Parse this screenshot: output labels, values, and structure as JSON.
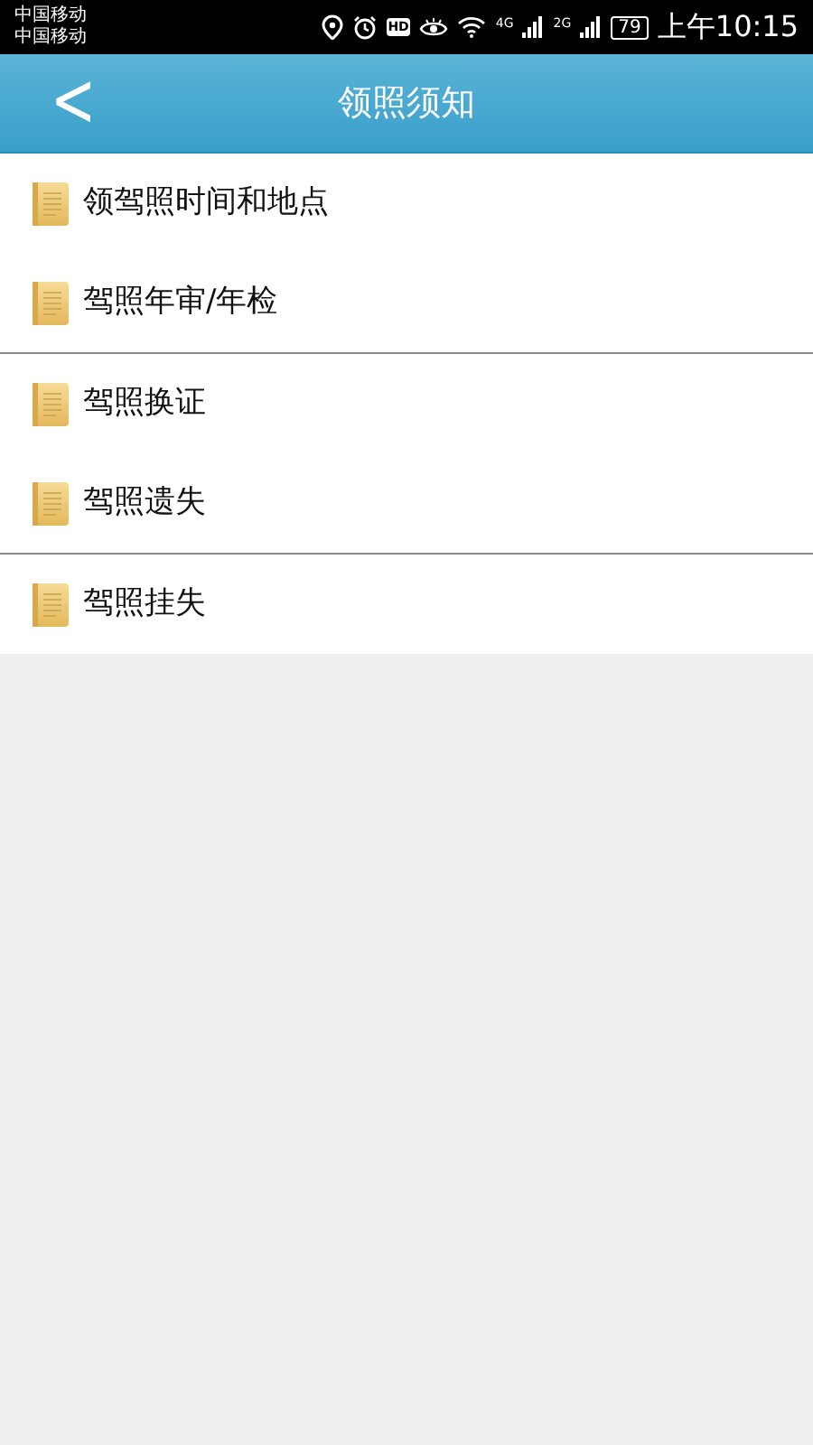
{
  "status_bar": {
    "carriers": [
      "中国移动",
      "中国移动"
    ],
    "hd_label": "HD",
    "signals": [
      "4G",
      "2G"
    ],
    "battery": "79",
    "time": "上午10:15"
  },
  "header": {
    "back": "<",
    "title": "领照须知"
  },
  "groups": [
    {
      "items": [
        "领驾照时间和地点",
        "驾照年审/年检"
      ]
    },
    {
      "items": [
        "驾照换证",
        "驾照遗失"
      ]
    },
    {
      "items": [
        "驾照挂失"
      ]
    }
  ]
}
